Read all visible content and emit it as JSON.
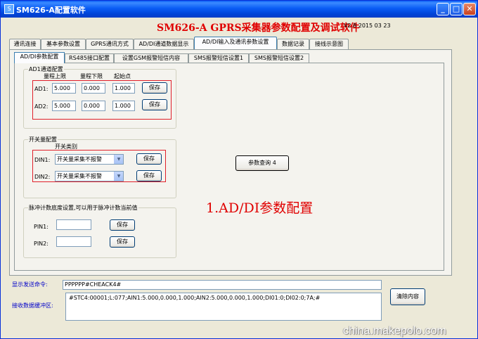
{
  "window": {
    "title": "SM626-A配置软件",
    "minimize": "_",
    "maximize": "□",
    "close": "✕"
  },
  "header": {
    "title": "SM626-A GPRS采集器参数配置及调试软件",
    "version": "V2.8 2015 03 23"
  },
  "tabs": [
    {
      "label": "通讯连接"
    },
    {
      "label": "基本参数设置"
    },
    {
      "label": "GPRS通讯方式"
    },
    {
      "label": "AD/DI通道数据显示"
    },
    {
      "label": "AD/DI输入及通讯参数设置"
    },
    {
      "label": "数据记录"
    },
    {
      "label": "接线示意图"
    }
  ],
  "subtabs": [
    {
      "label": "AD/DI参数配置"
    },
    {
      "label": "RS485接口配置"
    },
    {
      "label": "设置GSM报警短信内容"
    },
    {
      "label": "SMS报警短信设置1"
    },
    {
      "label": "SMS报警短信设置2"
    }
  ],
  "ad_group": {
    "title": "AD1通道配置",
    "col_upper": "量程上限",
    "col_lower": "量程下限",
    "col_start": "起始点",
    "rows": [
      {
        "label": "AD1:",
        "upper": "5.000",
        "lower": "0.000",
        "start": "1.000",
        "save": "保存"
      },
      {
        "label": "AD2:",
        "upper": "5.000",
        "lower": "0.000",
        "start": "1.000",
        "save": "保存"
      }
    ]
  },
  "switch_group": {
    "title": "开关量配置",
    "type_label": "开关类别",
    "rows": [
      {
        "label": "DIN1:",
        "value": "开关量采集不报警",
        "save": "保存"
      },
      {
        "label": "DIN2:",
        "value": "开关量采集不报警",
        "save": "保存"
      }
    ]
  },
  "pulse_group": {
    "title": "脉冲计数底度设置,可以用于脉冲计数当前值",
    "rows": [
      {
        "label": "PIN1:",
        "value": "",
        "save": "保存"
      },
      {
        "label": "PIN2:",
        "value": "",
        "save": "保存"
      }
    ]
  },
  "query_button": "参数查询 4",
  "annotation": "1.AD/DI参数配置",
  "send": {
    "label": "显示发送命令:",
    "value": "PPPPPP#CHEACK4#"
  },
  "receive": {
    "label": "接收数据缓冲区:",
    "value": "#STC4:00001;L:077;AIN1:5.000,0.000,1.000;AIN2:5.000,0.000,1.000;DI01:0;DI02:0;7A;#"
  },
  "clear_button": "清除内容",
  "watermark": "china.makepolo.com"
}
